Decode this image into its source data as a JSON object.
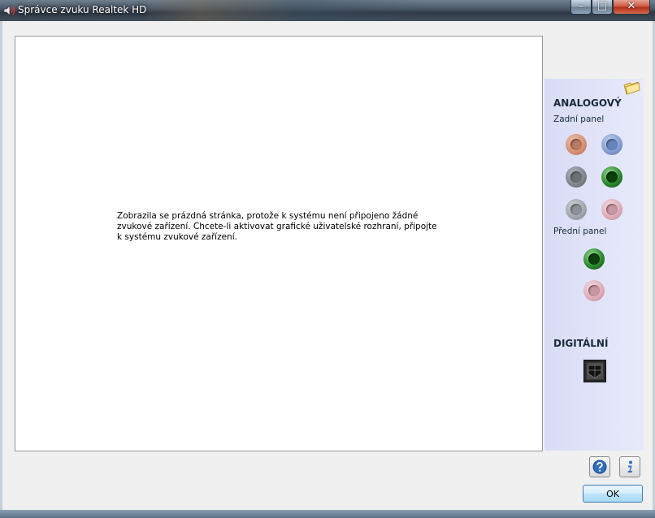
{
  "window": {
    "title": "Správce zvuku Realtek HD",
    "minimize_label": "–",
    "maximize_label": "□",
    "close_label": "✕"
  },
  "main": {
    "message": "Zobrazila se prázdná stránka, protože k systému není připojeno žádné zvukové zařízení. Chcete-li aktivovat grafické uživatelské rozhraní, připojte k systému zvukové zařízení."
  },
  "side_panel": {
    "analog_heading": "ANALOGOVÝ",
    "rear_panel_label": "Zadní panel",
    "front_panel_label": "Přední panel",
    "digital_heading": "DIGITÁLNÍ",
    "rear_jacks": [
      "orange",
      "blue",
      "gray",
      "green",
      "light-gray",
      "pink"
    ],
    "front_jacks": [
      "green",
      "pink"
    ]
  },
  "footer": {
    "ok_label": "OK"
  },
  "colors": {
    "jack_orange": "#d58e72",
    "jack_blue": "#7f9bd0",
    "jack_green": "#2c8a2c",
    "jack_pink": "#dcaab6",
    "side_panel_bg": "#e0e3f8",
    "ok_border": "#3c7fb1"
  }
}
